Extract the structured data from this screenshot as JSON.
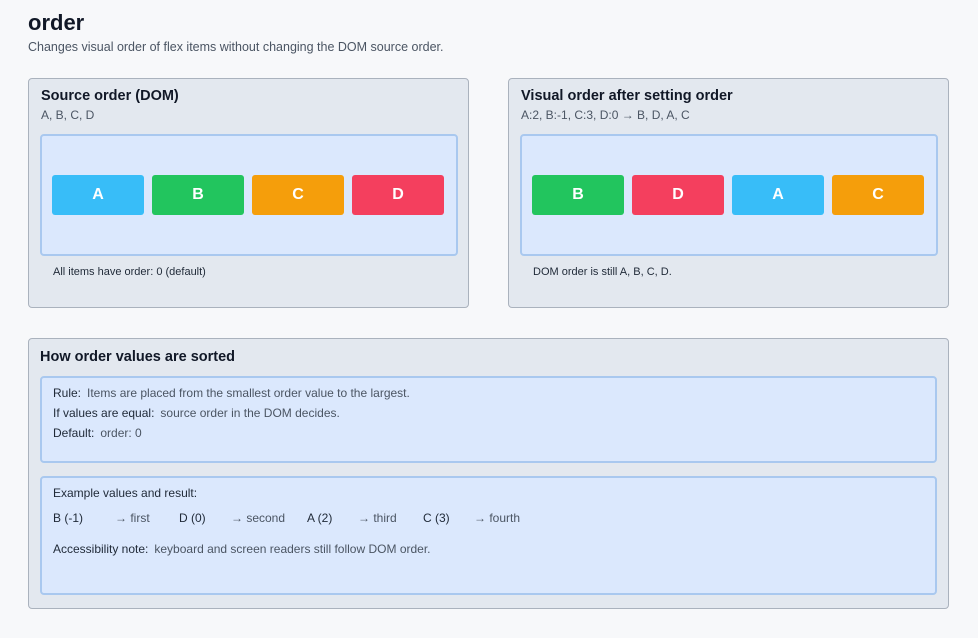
{
  "header": {
    "title": "order",
    "subtitle": "Changes visual order of flex items without changing the DOM source order."
  },
  "colors": {
    "A": "#38bdf8",
    "B": "#22c55e",
    "C": "#f59e0b",
    "D": "#f43f5e"
  },
  "source_panel": {
    "title": "Source order (DOM)",
    "subtitle": "A, B, C, D",
    "items": [
      "A",
      "B",
      "C",
      "D"
    ],
    "note": "All items have order: 0 (default)"
  },
  "visual_panel": {
    "title": "Visual order after setting order",
    "subtitle": "A:2, B:-1, C:3, D:0 → B, D, A, C",
    "items": [
      "B",
      "D",
      "A",
      "C"
    ],
    "note": "DOM order is still A, B, C, D."
  },
  "sorting": {
    "title": "How order values are sorted",
    "rule_label": "Rule:",
    "rule_value": "Items are placed from the smallest order value to the largest.",
    "equal_label": "If values are equal:",
    "equal_value": "source order in the DOM decides.",
    "default_label": "Default:",
    "default_value": "order: 0",
    "example_heading": "Example values and result:",
    "examples": [
      {
        "label": "B (-1)",
        "result": "→ first"
      },
      {
        "label": "D (0)",
        "result": "→ second"
      },
      {
        "label": "A (2)",
        "result": "→ third"
      },
      {
        "label": "C (3)",
        "result": "→ fourth"
      }
    ],
    "a11y_label": "Accessibility note:",
    "a11y_value": "keyboard and screen readers still follow DOM order."
  }
}
